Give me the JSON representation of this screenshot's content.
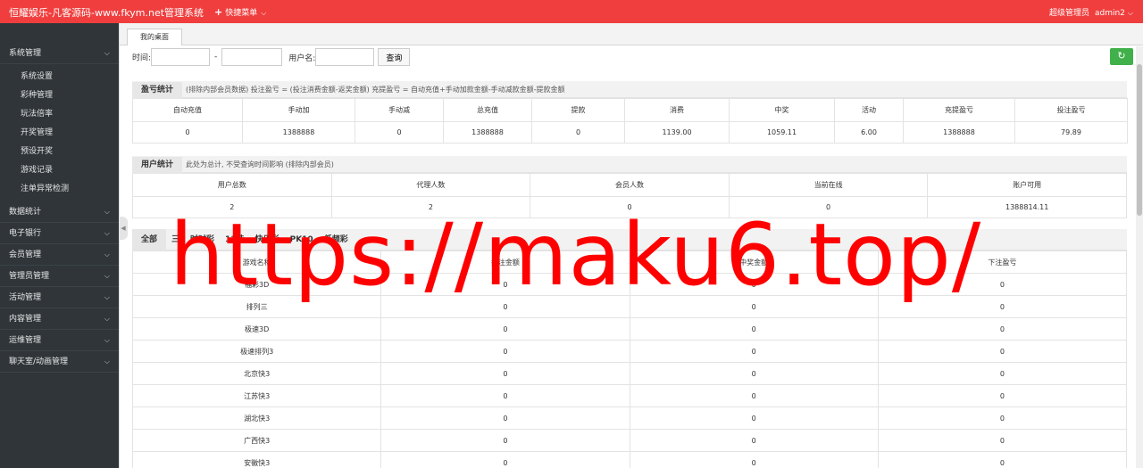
{
  "header": {
    "brand": "恒耀娱乐-凡客源码-www.fkym.net管理系统",
    "quick_menu": "快捷菜单",
    "role": "超级管理员",
    "username": "admin2"
  },
  "sidebar": {
    "groups": [
      {
        "label": "系统管理",
        "expanded": true,
        "items": [
          "系统设置",
          "彩种管理",
          "玩法倍率",
          "开奖管理",
          "预设开奖",
          "游戏记录",
          "注单异常检测"
        ]
      },
      {
        "label": "数据统计"
      },
      {
        "label": "电子银行"
      },
      {
        "label": "会员管理"
      },
      {
        "label": "管理员管理"
      },
      {
        "label": "活动管理"
      },
      {
        "label": "内容管理"
      },
      {
        "label": "运维管理"
      },
      {
        "label": "聊天室/动画管理"
      }
    ]
  },
  "tabs": [
    "我的桌面"
  ],
  "filter": {
    "time_label": "时间:",
    "separator": "-",
    "user_label": "用户名:",
    "query_button": "查询"
  },
  "profit_section": {
    "title": "盈亏统计",
    "description": "(排除内部会员数据)  投注盈亏 = (投注消费金额-返奖金额)     充提盈亏 = 自动充值+手动加款金额-手动减款金额-提款金额",
    "columns": [
      "自动充值",
      "手动加",
      "手动减",
      "总充值",
      "提款",
      "消费",
      "中奖",
      "活动",
      "充提盈亏",
      "投注盈亏"
    ],
    "row": [
      "0",
      "1388888",
      "0",
      "1388888",
      "0",
      "1139.00",
      "1059.11",
      "6.00",
      "1388888",
      "79.89"
    ]
  },
  "user_section": {
    "title": "用户统计",
    "description": "此处为总计, 不受查询时间影响 (排除内部会员)",
    "columns": [
      "用户总数",
      "代理人数",
      "会员人数",
      "当前在线",
      "账户可用"
    ],
    "row": [
      "2",
      "2",
      "0",
      "0",
      "1388814.11"
    ]
  },
  "game_section": {
    "categories": [
      "全部",
      "三",
      "时时彩",
      "11选",
      "快乐彩",
      "PK10",
      "低频彩"
    ],
    "columns": [
      "游戏名称",
      "投注金额",
      "中奖金额",
      "下注盈亏"
    ],
    "rows": [
      [
        "福彩3D",
        "0",
        "0",
        "0"
      ],
      [
        "排列三",
        "0",
        "0",
        "0"
      ],
      [
        "极速3D",
        "0",
        "0",
        "0"
      ],
      [
        "极速排列3",
        "0",
        "0",
        "0"
      ],
      [
        "北京快3",
        "0",
        "0",
        "0"
      ],
      [
        "江苏快3",
        "0",
        "0",
        "0"
      ],
      [
        "湖北快3",
        "0",
        "0",
        "0"
      ],
      [
        "广西快3",
        "0",
        "0",
        "0"
      ],
      [
        "安徽快3",
        "0",
        "0",
        "0"
      ]
    ]
  },
  "watermark": "https://maku6.top/"
}
